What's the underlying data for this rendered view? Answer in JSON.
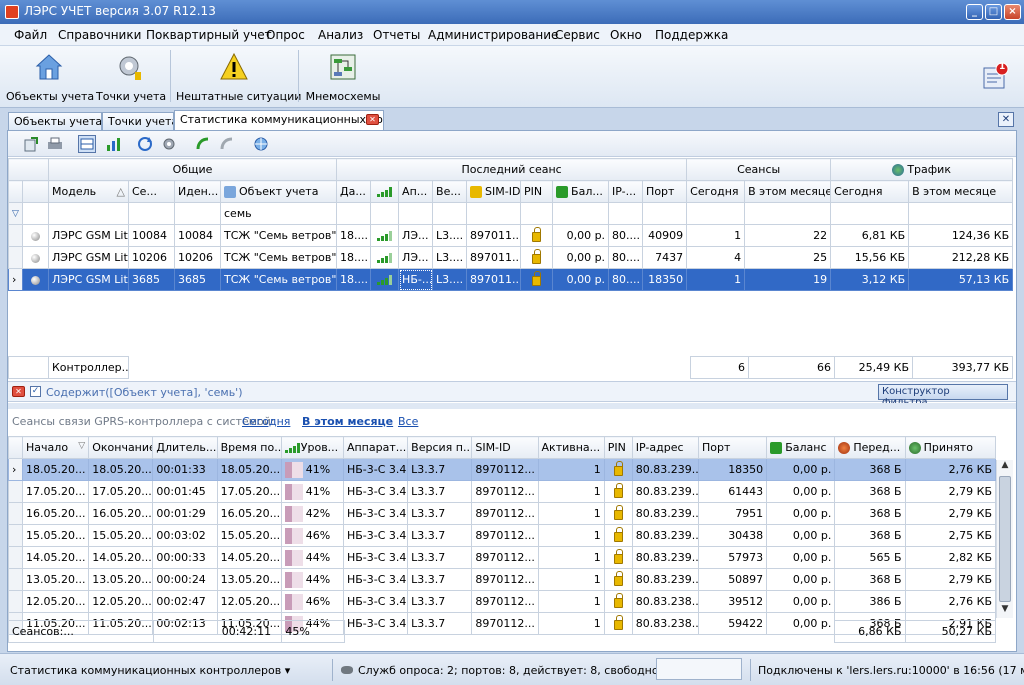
{
  "window": {
    "title": "ЛЭРС УЧЕТ версия 3.07 R12.13"
  },
  "menu": [
    "Файл",
    "Справочники",
    "Поквартирный учет",
    "Опрос",
    "Анализ",
    "Отчеты",
    "Администрирование",
    "Сервис",
    "Окно",
    "Поддержка"
  ],
  "ribbon": {
    "objects": "Объекты учета",
    "points": "Точки учета",
    "emergency": "Нештатные ситуации",
    "schemes": "Мнемосхемы",
    "notif_count": "1"
  },
  "tabs": [
    {
      "label": "Объекты учета"
    },
    {
      "label": "Точки учета"
    },
    {
      "label": "Статистика коммуникационных ко"
    }
  ],
  "top_grid": {
    "groups": {
      "general": "Общие",
      "last_session": "Последний сеанс",
      "sessions": "Сеансы",
      "traffic": "Трафик"
    },
    "headers": [
      "Модель",
      "Се...",
      "Иден...",
      "Объект учета",
      "Да...",
      "",
      "Ап...",
      "Ве...",
      "SIM-ID",
      "PIN",
      "Бал...",
      "IP-...",
      "Порт",
      "Сегодня",
      "В этом месяце",
      "Сегодня",
      "В этом месяце"
    ],
    "filter_value": "семь",
    "rows": [
      {
        "model": "ЛЭРС GSM Lite",
        "serial": "10084",
        "ident": "10084",
        "object": "ТСЖ \"Семь ветров\"",
        "date": "18....",
        "app": "ЛЭ...",
        "ver": "L3....",
        "sim": "897011...",
        "balance": "0,00 р.",
        "ip": "80....",
        "port": "40909",
        "s_today": "1",
        "s_month": "22",
        "t_today": "6,81 КБ",
        "t_month": "124,36 КБ"
      },
      {
        "model": "ЛЭРС GSM Lite",
        "serial": "10206",
        "ident": "10206",
        "object": "ТСЖ \"Семь ветров\"",
        "date": "18....",
        "app": "ЛЭ...",
        "ver": "L3....",
        "sim": "897011...",
        "balance": "0,00 р.",
        "ip": "80....",
        "port": "7437",
        "s_today": "4",
        "s_month": "25",
        "t_today": "15,56 КБ",
        "t_month": "212,28 КБ"
      },
      {
        "model": "ЛЭРС GSM Lite",
        "serial": "3685",
        "ident": "3685",
        "object": "ТСЖ \"Семь ветров\"",
        "date": "18....",
        "app": "НБ-...",
        "ver": "L3....",
        "sim": "897011...",
        "balance": "0,00 р.",
        "ip": "80....",
        "port": "18350",
        "s_today": "1",
        "s_month": "19",
        "t_today": "3,12 КБ",
        "t_month": "57,13 КБ"
      }
    ],
    "footer": {
      "label": "Контроллер...",
      "s_today": "6",
      "s_month": "66",
      "t_today": "25,49 КБ",
      "t_month": "393,77 КБ"
    }
  },
  "filter": {
    "text": "Содержит([Объект учета], 'семь')",
    "builder": "Конструктор фильтра..."
  },
  "lower": {
    "caption": "Сеансы связи GPRS-контроллера с системой:",
    "link_today": "Сегодня",
    "link_month": "В этом месяце",
    "link_all": "Все",
    "headers": [
      "Начало",
      "Окончание",
      "Длитель...",
      "Время по...",
      "Уров...",
      "Аппарат...",
      "Версия п...",
      "SIM-ID",
      "Активна...",
      "PIN",
      "IP-адрес",
      "Порт",
      "Баланс",
      "Перед...",
      "Принято"
    ],
    "rows": [
      {
        "start": "18.05.20...",
        "end": "18.05.20...",
        "dur": "00:01:33",
        "time": "18.05.20...",
        "level": "41%",
        "dev": "НБ-3-С 3.4",
        "ver": "L3.3.7",
        "sim": "8970112...",
        "act": "1",
        "ip": "80.83.239...",
        "port": "18350",
        "bal": "0,00 р.",
        "sent": "368 Б",
        "recv": "2,76 КБ"
      },
      {
        "start": "17.05.20...",
        "end": "17.05.20...",
        "dur": "00:01:45",
        "time": "17.05.20...",
        "level": "41%",
        "dev": "НБ-3-С 3.4",
        "ver": "L3.3.7",
        "sim": "8970112...",
        "act": "1",
        "ip": "80.83.239...",
        "port": "61443",
        "bal": "0,00 р.",
        "sent": "368 Б",
        "recv": "2,79 КБ"
      },
      {
        "start": "16.05.20...",
        "end": "16.05.20...",
        "dur": "00:01:29",
        "time": "16.05.20...",
        "level": "42%",
        "dev": "НБ-3-С 3.4",
        "ver": "L3.3.7",
        "sim": "8970112...",
        "act": "1",
        "ip": "80.83.239...",
        "port": "7951",
        "bal": "0,00 р.",
        "sent": "368 Б",
        "recv": "2,79 КБ"
      },
      {
        "start": "15.05.20...",
        "end": "15.05.20...",
        "dur": "00:03:02",
        "time": "15.05.20...",
        "level": "46%",
        "dev": "НБ-3-С 3.4",
        "ver": "L3.3.7",
        "sim": "8970112...",
        "act": "1",
        "ip": "80.83.239...",
        "port": "30438",
        "bal": "0,00 р.",
        "sent": "368 Б",
        "recv": "2,75 КБ"
      },
      {
        "start": "14.05.20...",
        "end": "14.05.20...",
        "dur": "00:00:33",
        "time": "14.05.20...",
        "level": "44%",
        "dev": "НБ-3-С 3.4",
        "ver": "L3.3.7",
        "sim": "8970112...",
        "act": "1",
        "ip": "80.83.239...",
        "port": "57973",
        "bal": "0,00 р.",
        "sent": "565 Б",
        "recv": "2,82 КБ"
      },
      {
        "start": "13.05.20...",
        "end": "13.05.20...",
        "dur": "00:00:24",
        "time": "13.05.20...",
        "level": "44%",
        "dev": "НБ-3-С 3.4",
        "ver": "L3.3.7",
        "sim": "8970112...",
        "act": "1",
        "ip": "80.83.239...",
        "port": "50897",
        "bal": "0,00 р.",
        "sent": "368 Б",
        "recv": "2,79 КБ"
      },
      {
        "start": "12.05.20...",
        "end": "12.05.20...",
        "dur": "00:02:47",
        "time": "12.05.20...",
        "level": "46%",
        "dev": "НБ-3-С 3.4",
        "ver": "L3.3.7",
        "sim": "8970112...",
        "act": "1",
        "ip": "80.83.238...",
        "port": "39512",
        "bal": "0,00 р.",
        "sent": "386 Б",
        "recv": "2,76 КБ"
      },
      {
        "start": "11.05.20...",
        "end": "11.05.20...",
        "dur": "00:02:13",
        "time": "11.05.20...",
        "level": "44%",
        "dev": "НБ-3-С 3.4",
        "ver": "L3.3.7",
        "sim": "8970112...",
        "act": "1",
        "ip": "80.83.238...",
        "port": "59422",
        "bal": "0,00 р.",
        "sent": "368 Б",
        "recv": "2,91 КБ"
      }
    ],
    "footer": {
      "count": "Сеансов:...",
      "dur": "00:42:11",
      "level": "45%",
      "sent": "6,86 КБ",
      "recv": "50,27 КБ"
    }
  },
  "status": {
    "view": "Статистика коммуникационных контроллеров",
    "services": "Служб опроса: 2; портов: 8, действует: 8, свободно: 8",
    "connection": "Подключены к 'lers.lers.ru:10000' в 16:56 (17 май)"
  }
}
